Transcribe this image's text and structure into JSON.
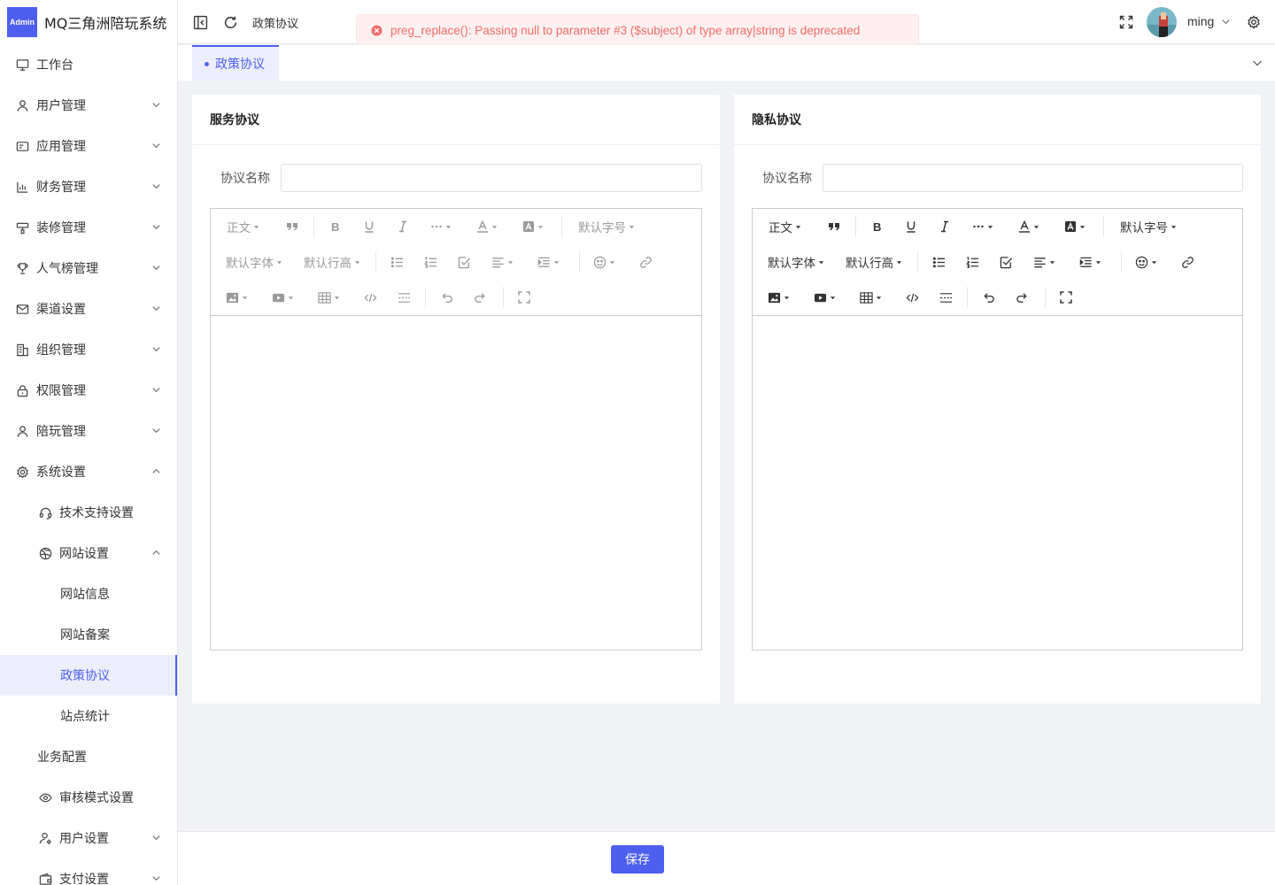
{
  "app": {
    "logo_text": "Admin",
    "title": "MQ三角洲陪玩系统"
  },
  "header": {
    "breadcrumb": "政策协议",
    "error_message": "preg_replace(): Passing null to parameter #3 ($subject) of type array|string is deprecated",
    "username": "ming"
  },
  "tags": {
    "active": "政策协议"
  },
  "sidebar": {
    "items": [
      {
        "label": "工作台",
        "icon": "monitor-icon"
      },
      {
        "label": "用户管理",
        "icon": "user-icon"
      },
      {
        "label": "应用管理",
        "icon": "app-icon"
      },
      {
        "label": "财务管理",
        "icon": "chart-icon"
      },
      {
        "label": "装修管理",
        "icon": "brush-icon"
      },
      {
        "label": "人气榜管理",
        "icon": "trophy-icon"
      },
      {
        "label": "渠道设置",
        "icon": "mail-icon"
      },
      {
        "label": "组织管理",
        "icon": "building-icon"
      },
      {
        "label": "权限管理",
        "icon": "lock-icon"
      },
      {
        "label": "陪玩管理",
        "icon": "user-icon"
      },
      {
        "label": "系统设置",
        "icon": "gear-icon"
      },
      {
        "label": "技术支持设置",
        "icon": "headset-icon"
      },
      {
        "label": "网站设置",
        "icon": "globe-icon"
      },
      {
        "label": "网站信息"
      },
      {
        "label": "网站备案"
      },
      {
        "label": "政策协议"
      },
      {
        "label": "站点统计"
      },
      {
        "label": "业务配置"
      },
      {
        "label": "审核模式设置",
        "icon": "eye-icon"
      },
      {
        "label": "用户设置",
        "icon": "user-settings-icon"
      },
      {
        "label": "支付设置",
        "icon": "wallet-icon"
      }
    ]
  },
  "editor_toolbar": {
    "heading": "正文",
    "font_size": "默认字号",
    "font_family": "默认字体",
    "line_height": "默认行高"
  },
  "cards": [
    {
      "title": "服务协议",
      "field_label": "协议名称",
      "field_value": ""
    },
    {
      "title": "隐私协议",
      "field_label": "协议名称",
      "field_value": ""
    }
  ],
  "footer": {
    "save_label": "保存"
  },
  "colors": {
    "primary": "#4e5ff0",
    "error": "#f56c6c"
  }
}
